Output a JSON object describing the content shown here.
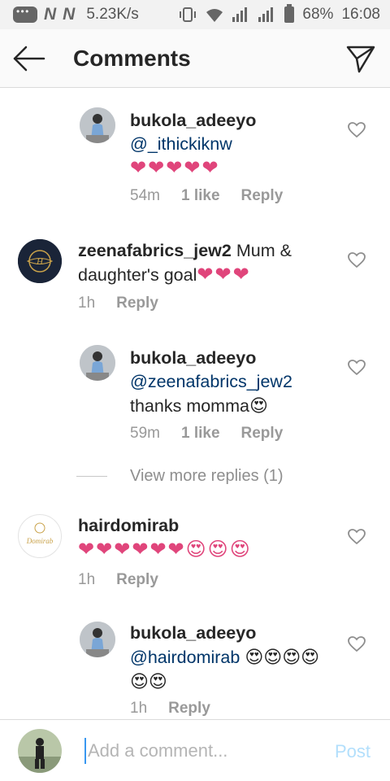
{
  "status_bar": {
    "speed": "5.23K/s",
    "battery": "68%",
    "time": "16:08",
    "icons": [
      "chat-icon",
      "n-icon",
      "n-icon",
      "vibrate-icon",
      "wifi-icon",
      "signal-icon",
      "battery-icon"
    ]
  },
  "header": {
    "title": "Comments",
    "back_icon": "arrow-left-icon",
    "send_icon": "direct-send-icon"
  },
  "comments": [
    {
      "username": "bukola_adeeyo",
      "mention": "@_ithickiknw",
      "text": "",
      "emojis": "❤❤❤❤❤",
      "time": "54m",
      "likes": "1 like",
      "reply": "Reply",
      "is_reply": true
    },
    {
      "username": "zeenafabrics_jew2",
      "mention": "",
      "text": "Mum & daughter's goal",
      "emojis": "❤❤❤",
      "time": "1h",
      "likes": "",
      "reply": "Reply",
      "is_reply": false
    },
    {
      "username": "bukola_adeeyo",
      "mention": "@zeenafabrics_jew2",
      "text": "thanks momma",
      "emojis": "😍",
      "time": "59m",
      "likes": "1 like",
      "reply": "Reply",
      "is_reply": true
    },
    {
      "username": "hairdomirab",
      "mention": "",
      "text": "",
      "emojis": "❤❤❤❤❤❤😍😍😍",
      "time": "1h",
      "likes": "",
      "reply": "Reply",
      "is_reply": false
    },
    {
      "username": "bukola_adeeyo",
      "mention": "@hairdomirab",
      "text": "",
      "emojis": "😍😍😍😍😍😍",
      "time": "1h",
      "likes": "",
      "reply": "Reply",
      "is_reply": true
    }
  ],
  "view_more": "View more replies (1)",
  "avatars": {
    "hairdomirab_logo": "Domirab"
  },
  "composer": {
    "placeholder": "Add a comment...",
    "post_label": "Post"
  },
  "colors": {
    "heart_pink": "#e0457b",
    "mention_blue": "#003569",
    "post_disabled": "#b2dffc",
    "cursor_blue": "#3897f0"
  }
}
